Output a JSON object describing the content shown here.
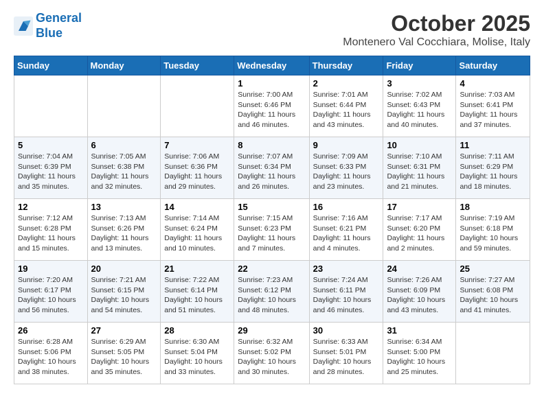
{
  "header": {
    "logo_line1": "General",
    "logo_line2": "Blue",
    "month_title": "October 2025",
    "location": "Montenero Val Cocchiara, Molise, Italy"
  },
  "weekdays": [
    "Sunday",
    "Monday",
    "Tuesday",
    "Wednesday",
    "Thursday",
    "Friday",
    "Saturday"
  ],
  "weeks": [
    [
      {
        "day": "",
        "info": ""
      },
      {
        "day": "",
        "info": ""
      },
      {
        "day": "",
        "info": ""
      },
      {
        "day": "1",
        "info": "Sunrise: 7:00 AM\nSunset: 6:46 PM\nDaylight: 11 hours and 46 minutes."
      },
      {
        "day": "2",
        "info": "Sunrise: 7:01 AM\nSunset: 6:44 PM\nDaylight: 11 hours and 43 minutes."
      },
      {
        "day": "3",
        "info": "Sunrise: 7:02 AM\nSunset: 6:43 PM\nDaylight: 11 hours and 40 minutes."
      },
      {
        "day": "4",
        "info": "Sunrise: 7:03 AM\nSunset: 6:41 PM\nDaylight: 11 hours and 37 minutes."
      }
    ],
    [
      {
        "day": "5",
        "info": "Sunrise: 7:04 AM\nSunset: 6:39 PM\nDaylight: 11 hours and 35 minutes."
      },
      {
        "day": "6",
        "info": "Sunrise: 7:05 AM\nSunset: 6:38 PM\nDaylight: 11 hours and 32 minutes."
      },
      {
        "day": "7",
        "info": "Sunrise: 7:06 AM\nSunset: 6:36 PM\nDaylight: 11 hours and 29 minutes."
      },
      {
        "day": "8",
        "info": "Sunrise: 7:07 AM\nSunset: 6:34 PM\nDaylight: 11 hours and 26 minutes."
      },
      {
        "day": "9",
        "info": "Sunrise: 7:09 AM\nSunset: 6:33 PM\nDaylight: 11 hours and 23 minutes."
      },
      {
        "day": "10",
        "info": "Sunrise: 7:10 AM\nSunset: 6:31 PM\nDaylight: 11 hours and 21 minutes."
      },
      {
        "day": "11",
        "info": "Sunrise: 7:11 AM\nSunset: 6:29 PM\nDaylight: 11 hours and 18 minutes."
      }
    ],
    [
      {
        "day": "12",
        "info": "Sunrise: 7:12 AM\nSunset: 6:28 PM\nDaylight: 11 hours and 15 minutes."
      },
      {
        "day": "13",
        "info": "Sunrise: 7:13 AM\nSunset: 6:26 PM\nDaylight: 11 hours and 13 minutes."
      },
      {
        "day": "14",
        "info": "Sunrise: 7:14 AM\nSunset: 6:24 PM\nDaylight: 11 hours and 10 minutes."
      },
      {
        "day": "15",
        "info": "Sunrise: 7:15 AM\nSunset: 6:23 PM\nDaylight: 11 hours and 7 minutes."
      },
      {
        "day": "16",
        "info": "Sunrise: 7:16 AM\nSunset: 6:21 PM\nDaylight: 11 hours and 4 minutes."
      },
      {
        "day": "17",
        "info": "Sunrise: 7:17 AM\nSunset: 6:20 PM\nDaylight: 11 hours and 2 minutes."
      },
      {
        "day": "18",
        "info": "Sunrise: 7:19 AM\nSunset: 6:18 PM\nDaylight: 10 hours and 59 minutes."
      }
    ],
    [
      {
        "day": "19",
        "info": "Sunrise: 7:20 AM\nSunset: 6:17 PM\nDaylight: 10 hours and 56 minutes."
      },
      {
        "day": "20",
        "info": "Sunrise: 7:21 AM\nSunset: 6:15 PM\nDaylight: 10 hours and 54 minutes."
      },
      {
        "day": "21",
        "info": "Sunrise: 7:22 AM\nSunset: 6:14 PM\nDaylight: 10 hours and 51 minutes."
      },
      {
        "day": "22",
        "info": "Sunrise: 7:23 AM\nSunset: 6:12 PM\nDaylight: 10 hours and 48 minutes."
      },
      {
        "day": "23",
        "info": "Sunrise: 7:24 AM\nSunset: 6:11 PM\nDaylight: 10 hours and 46 minutes."
      },
      {
        "day": "24",
        "info": "Sunrise: 7:26 AM\nSunset: 6:09 PM\nDaylight: 10 hours and 43 minutes."
      },
      {
        "day": "25",
        "info": "Sunrise: 7:27 AM\nSunset: 6:08 PM\nDaylight: 10 hours and 41 minutes."
      }
    ],
    [
      {
        "day": "26",
        "info": "Sunrise: 6:28 AM\nSunset: 5:06 PM\nDaylight: 10 hours and 38 minutes."
      },
      {
        "day": "27",
        "info": "Sunrise: 6:29 AM\nSunset: 5:05 PM\nDaylight: 10 hours and 35 minutes."
      },
      {
        "day": "28",
        "info": "Sunrise: 6:30 AM\nSunset: 5:04 PM\nDaylight: 10 hours and 33 minutes."
      },
      {
        "day": "29",
        "info": "Sunrise: 6:32 AM\nSunset: 5:02 PM\nDaylight: 10 hours and 30 minutes."
      },
      {
        "day": "30",
        "info": "Sunrise: 6:33 AM\nSunset: 5:01 PM\nDaylight: 10 hours and 28 minutes."
      },
      {
        "day": "31",
        "info": "Sunrise: 6:34 AM\nSunset: 5:00 PM\nDaylight: 10 hours and 25 minutes."
      },
      {
        "day": "",
        "info": ""
      }
    ]
  ]
}
